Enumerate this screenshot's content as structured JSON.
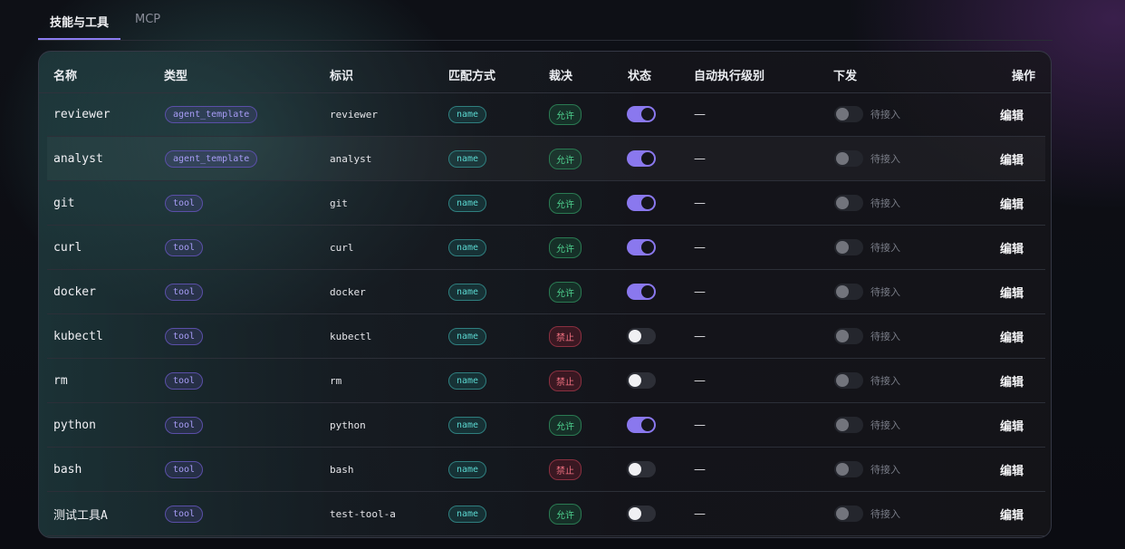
{
  "tabs": [
    {
      "label": "技能与工具",
      "active": true
    },
    {
      "label": "MCP",
      "active": false
    }
  ],
  "columns": [
    "名称",
    "类型",
    "标识",
    "匹配方式",
    "裁决",
    "状态",
    "自动执行级别",
    "下发",
    "操作"
  ],
  "pending_label": "待接入",
  "edit_label": "编辑",
  "rows": [
    {
      "name": "reviewer",
      "type": "agent_template",
      "id": "reviewer",
      "match": "name",
      "verdict": "允许",
      "verdict_kind": "allow",
      "enabled": true,
      "auto_level": "—"
    },
    {
      "name": "analyst",
      "type": "agent_template",
      "id": "analyst",
      "match": "name",
      "verdict": "允许",
      "verdict_kind": "allow",
      "enabled": true,
      "auto_level": "—"
    },
    {
      "name": "git",
      "type": "tool",
      "id": "git",
      "match": "name",
      "verdict": "允许",
      "verdict_kind": "allow",
      "enabled": true,
      "auto_level": "—"
    },
    {
      "name": "curl",
      "type": "tool",
      "id": "curl",
      "match": "name",
      "verdict": "允许",
      "verdict_kind": "allow",
      "enabled": true,
      "auto_level": "—"
    },
    {
      "name": "docker",
      "type": "tool",
      "id": "docker",
      "match": "name",
      "verdict": "允许",
      "verdict_kind": "allow",
      "enabled": true,
      "auto_level": "—"
    },
    {
      "name": "kubectl",
      "type": "tool",
      "id": "kubectl",
      "match": "name",
      "verdict": "禁止",
      "verdict_kind": "deny",
      "enabled": false,
      "auto_level": "—"
    },
    {
      "name": "rm",
      "type": "tool",
      "id": "rm",
      "match": "name",
      "verdict": "禁止",
      "verdict_kind": "deny",
      "enabled": false,
      "auto_level": "—"
    },
    {
      "name": "python",
      "type": "tool",
      "id": "python",
      "match": "name",
      "verdict": "允许",
      "verdict_kind": "allow",
      "enabled": true,
      "auto_level": "—"
    },
    {
      "name": "bash",
      "type": "tool",
      "id": "bash",
      "match": "name",
      "verdict": "禁止",
      "verdict_kind": "deny",
      "enabled": false,
      "auto_level": "—"
    },
    {
      "name": "测试工具A",
      "type": "tool",
      "id": "test-tool-a",
      "match": "name",
      "verdict": "允许",
      "verdict_kind": "allow",
      "enabled": false,
      "auto_level": "—"
    }
  ],
  "colors": {
    "accent": "#8a78ee",
    "allow": "#4ed08e",
    "deny": "#f07080",
    "match": "#5ad6cf"
  }
}
